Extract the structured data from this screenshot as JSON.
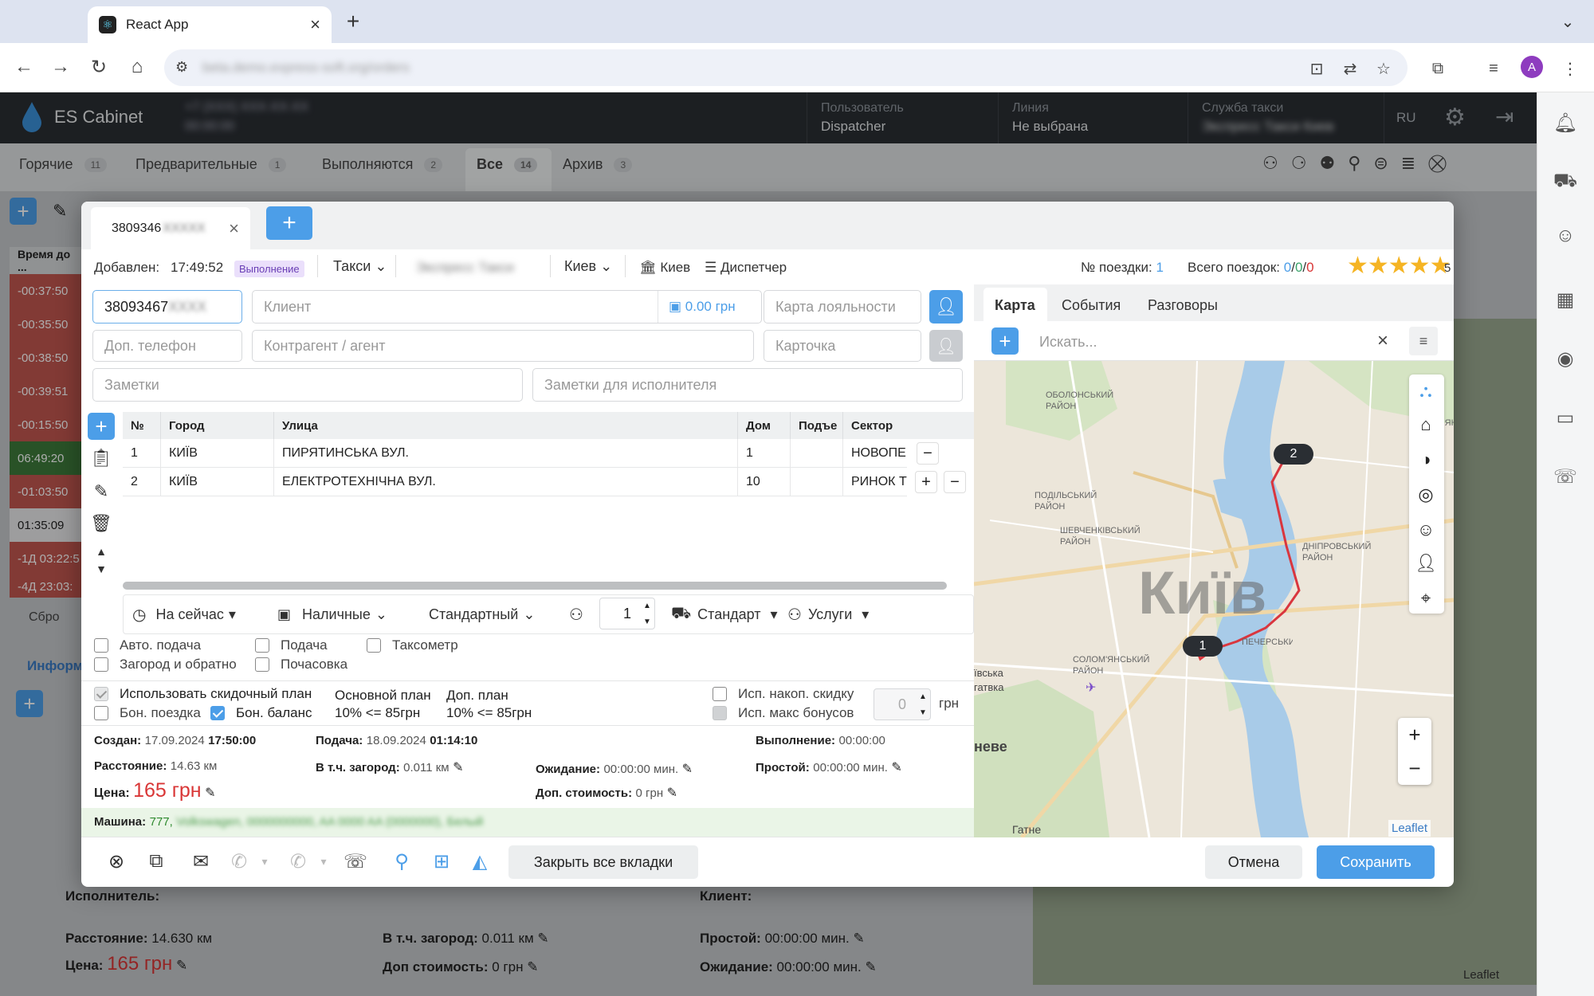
{
  "browser": {
    "tab_title": "React App",
    "new_tab": "+",
    "url_placeholder": "beta.demo.express-soft.org/orders"
  },
  "app": {
    "title": "ES Cabinet",
    "header_left_line1": "+7 (XXX) XXX-XX-XX",
    "header_left_line2": "00:00:00",
    "user_label": "Пользователь",
    "user_value": "Dispatcher",
    "line_label": "Линия",
    "line_value": "Не выбрана",
    "service_label": "Служба такси",
    "service_value": "Экспресс Такси Киев",
    "lang": "RU"
  },
  "bg_tabs": [
    {
      "label": "Горячие",
      "count": "11"
    },
    {
      "label": "Предварительные",
      "count": "1"
    },
    {
      "label": "Выполняются",
      "count": "2"
    },
    {
      "label": "Все",
      "count": "14"
    },
    {
      "label": "Архив",
      "count": "3"
    }
  ],
  "bg_list": {
    "header": "Время до ...",
    "times": [
      "-00:37:50",
      "-00:35:50",
      "-00:38:50",
      "-00:39:51",
      "-00:15:50",
      "06:49:20",
      "-01:03:50",
      "01:35:09",
      "-1Д 03:22:5",
      "-4Д 23:03:"
    ],
    "reset": "Сбро",
    "info_tab": "Информ"
  },
  "bg_details": {
    "executor_label": "Исполнитель:",
    "client_label": "Клиент:",
    "distance_label": "Расстояние:",
    "distance_value": "14.630 км",
    "suburb_label": "В т.ч. загород:",
    "suburb_value": "0.011 км",
    "idle_label": "Простой:",
    "idle_value": "00:00:00 мин.",
    "price_label": "Цена:",
    "price_value": "165 грн",
    "extra_cost_label": "Доп стоимость:",
    "extra_cost_value": "0 грн",
    "wait_label": "Ожидание:",
    "wait_value": "00:00:00 мин.",
    "leaflet": "Leaflet"
  },
  "order": {
    "tab_phone": "3809346",
    "tab_phone_hidden": "XXXXX",
    "added_label": "Добавлен:",
    "added_time": "17:49:52",
    "status": "Выполнение",
    "service_type": "Такси",
    "service_name": "Экспресс Такси",
    "city": "Киев",
    "city2": "Киев",
    "source": "Диспетчер",
    "trip_no_label": "№ поездки:",
    "trip_no": "1",
    "trips_total_label": "Всего поездок:",
    "trips_a": "0",
    "trips_b": "0",
    "trips_c": "0",
    "rating_digit": "5",
    "phone_value": "38093467",
    "phone_hidden": "XXXX",
    "client_placeholder": "Клиент",
    "balance": "0.00 грн",
    "loyalty_placeholder": "Карта лояльности",
    "extra_phone_placeholder": "Доп. телефон",
    "contractor_placeholder": "Контрагент / агент",
    "card_placeholder": "Карточка",
    "notes_placeholder": "Заметки",
    "driver_notes_placeholder": "Заметки для исполнителя"
  },
  "route_table": {
    "headers": [
      "№",
      "Город",
      "Улица",
      "Дом",
      "Подъе",
      "Сектор"
    ],
    "rows": [
      {
        "n": "1",
        "city": "КИЇВ",
        "street": "ПИРЯТИНСЬКА ВУЛ.",
        "house": "1",
        "entrance": "",
        "sector": "НОВОПЕЧ"
      },
      {
        "n": "2",
        "city": "КИЇВ",
        "street": "ЕЛЕКТРОТЕХНІЧНА ВУЛ.",
        "house": "10",
        "entrance": "",
        "sector": "РИНОК ТІ"
      }
    ]
  },
  "options": {
    "time": "На сейчас",
    "payment": "Наличные",
    "tariff": "Стандартный",
    "passengers": "1",
    "car_class": "Стандарт",
    "services": "Услуги"
  },
  "checkboxes": {
    "auto_pickup": "Авто. подача",
    "pickup": "Подача",
    "taximeter": "Таксометр",
    "roundtrip": "Загород и обратно",
    "hourly": "Почасовка",
    "use_discount": "Использовать скидочный план",
    "main_plan_label": "Основной план",
    "main_plan_value": "10% <= 85грн",
    "extra_plan_label": "Доп. план",
    "extra_plan_value": "10% <= 85грн",
    "bonus_trip": "Бон. поездка",
    "bonus_balance": "Бон. баланс",
    "acc_discount": "Исп. накоп. скидку",
    "max_bonus": "Исп. макс бонусов",
    "discount_amount": "0",
    "currency": "грн"
  },
  "summary": {
    "created_label": "Создан:",
    "created_date": "17.09.2024",
    "created_time": "17:50:00",
    "pickup_label": "Подача:",
    "pickup_date": "18.09.2024",
    "pickup_time": "01:14:10",
    "done_label": "Выполнение:",
    "done_value": "00:00:00",
    "distance_label": "Расстояние:",
    "distance_value": "14.63 км",
    "suburb_label": "В т.ч. загород:",
    "suburb_value": "0.011 км",
    "wait_label": "Ожидание:",
    "wait_value": "00:00:00 мин.",
    "idle_label": "Простой:",
    "idle_value": "00:00:00 мин.",
    "price_label": "Цена:",
    "price_value": "165 грн",
    "extra_label": "Доп. стоимость:",
    "extra_value": "0 грн",
    "car_label": "Машина:",
    "car_value": "777,",
    "car_hidden": "Volkswagen, 0000000000, AA 0000 AA (0000000), Белый"
  },
  "footer": {
    "close_all": "Закрыть все вкладки",
    "cancel": "Отмена",
    "save": "Сохранить"
  },
  "map_panel": {
    "tabs": [
      "Карта",
      "События",
      "Разговоры"
    ],
    "search_placeholder": "Искать...",
    "city_label": "Київ",
    "district_labels": [
      "ОБОЛОНСЬКИЙ РАЙОН",
      "ПОДІЛЬСЬКИЙ РАЙОН",
      "ШЕВЧЕНКІВСЬКИЙ РАЙОН",
      "ДНІПРОВСЬКИЙ РАЙОН",
      "СОЛОМ'ЯНСЬКИЙ РАЙОН",
      "ПЕЧЕРСЬКИЙ",
      "ДЕСНЯНСЬКИЙ"
    ],
    "town_labels": [
      "ївська",
      "гатвка",
      "неве",
      "Гатне"
    ],
    "marker_start": "1",
    "marker_end": "2",
    "zoom_in": "+",
    "zoom_out": "−",
    "attribution": "Leaflet"
  },
  "colors": {
    "accent": "#4c9ee8",
    "header_bg": "#2a2e33",
    "price_red": "#d93636",
    "route_red": "#d9363e",
    "star": "#f5b423"
  }
}
